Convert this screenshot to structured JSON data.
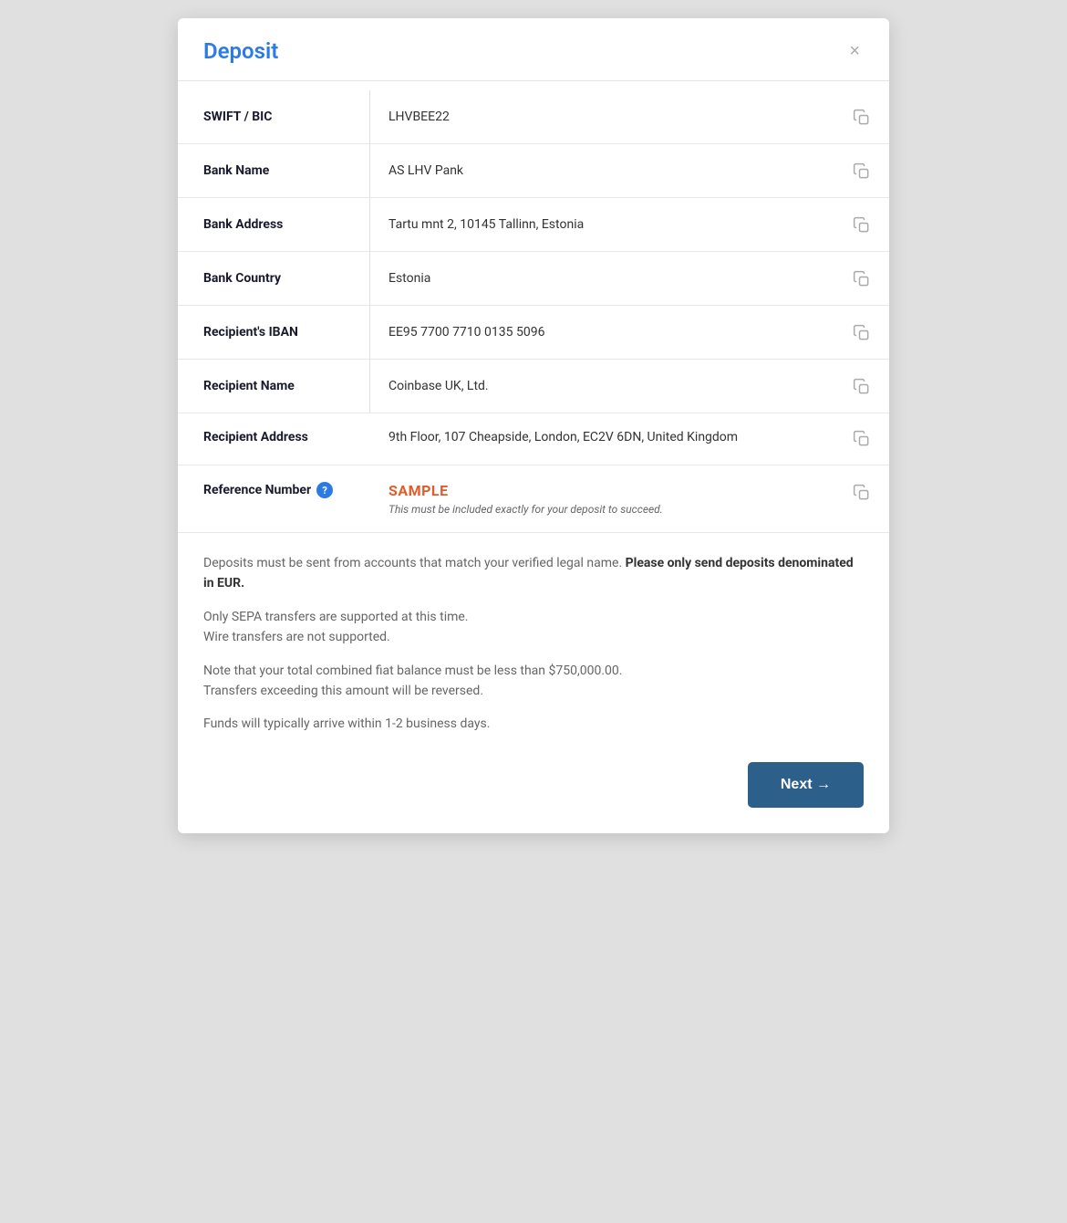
{
  "modal": {
    "title": "Deposit",
    "close_label": "×"
  },
  "rows": [
    {
      "label": "SWIFT / BIC",
      "value": "LHVBEE22",
      "has_help": false,
      "multiline": false
    },
    {
      "label": "Bank Name",
      "value": "AS LHV Pank",
      "has_help": false,
      "multiline": false
    },
    {
      "label": "Bank Address",
      "value": "Tartu mnt 2, 10145 Tallinn, Estonia",
      "has_help": false,
      "multiline": false
    },
    {
      "label": "Bank Country",
      "value": "Estonia",
      "has_help": false,
      "multiline": false
    },
    {
      "label": "Recipient's IBAN",
      "value": "EE95 7700 7710 0135 5096",
      "has_help": false,
      "multiline": false
    },
    {
      "label": "Recipient Name",
      "value": "Coinbase UK, Ltd.",
      "has_help": false,
      "multiline": false
    },
    {
      "label": "Recipient Address",
      "value": "9th Floor, 107 Cheapside, London, EC2V 6DN, United Kingdom",
      "has_help": false,
      "multiline": true
    }
  ],
  "reference": {
    "label": "Reference Number",
    "value": "SAMPLE",
    "note": "This must be included exactly for your deposit to succeed."
  },
  "footer": {
    "paragraph1_normal": "Deposits must be sent from accounts that match your verified legal name. ",
    "paragraph1_bold": "Please only send deposits denominated in EUR.",
    "paragraph2_line1": "Only SEPA transfers are supported at this time.",
    "paragraph2_line2": "Wire transfers are not supported.",
    "paragraph3_line1": "Note that your total combined fiat balance must be less than $750,000.00.",
    "paragraph3_line2": "Transfers exceeding this amount will be reversed.",
    "paragraph4": "Funds will typically arrive within 1-2 business days."
  },
  "next_button": {
    "label": "Next →"
  }
}
